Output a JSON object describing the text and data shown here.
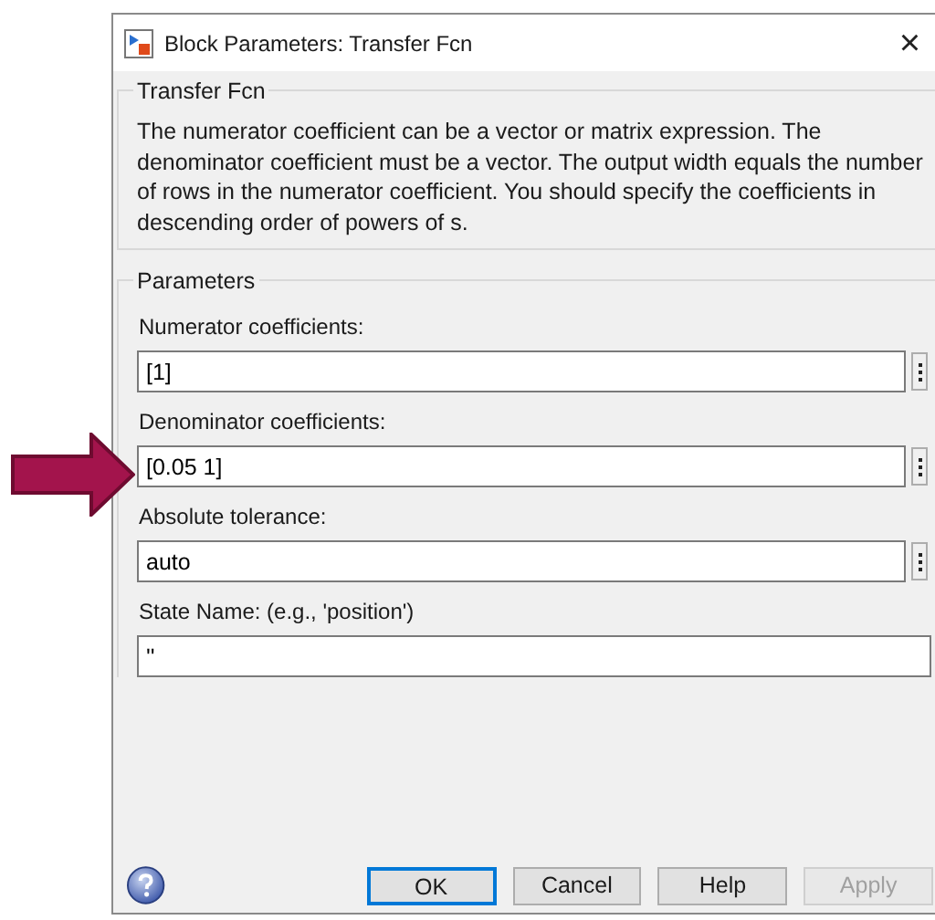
{
  "window": {
    "title": "Block Parameters: Transfer Fcn",
    "close": "×"
  },
  "description_group": {
    "title": "Transfer Fcn",
    "text": "The numerator coefficient can be a vector or matrix expression. The denominator coefficient must be a vector. The output width equals the number of rows in the numerator coefficient. You should specify the coefficients in descending order of powers of s."
  },
  "parameters_group": {
    "title": "Parameters",
    "fields": [
      {
        "kind": "expression",
        "label": "Numerator coefficients:",
        "value": "[1]"
      },
      {
        "kind": "expression",
        "label": "Denominator coefficients:",
        "value": "[0.05 1]"
      },
      {
        "kind": "expression",
        "label": "Absolute tolerance:",
        "value": "auto"
      },
      {
        "kind": "text",
        "label": "State Name: (e.g., 'position')",
        "value": "''"
      }
    ]
  },
  "buttons": [
    {
      "label": "OK",
      "default": true,
      "disabled": false
    },
    {
      "label": "Cancel",
      "default": false,
      "disabled": false
    },
    {
      "label": "Help",
      "default": false,
      "disabled": false
    },
    {
      "label": "Apply",
      "default": false,
      "disabled": true
    }
  ]
}
